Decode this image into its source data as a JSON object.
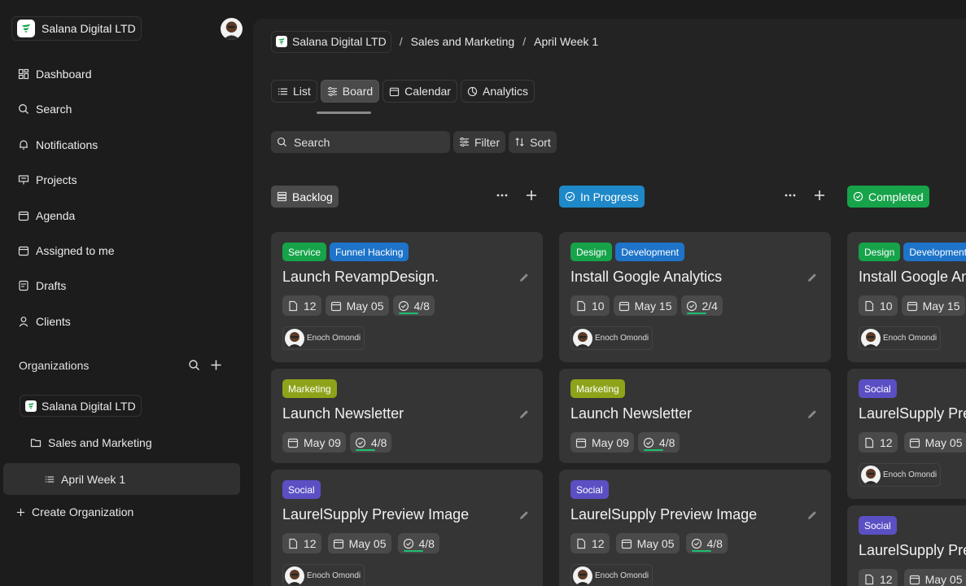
{
  "workspace": {
    "name": "Salana Digital LTD"
  },
  "sidebar": {
    "nav": [
      {
        "label": "Dashboard",
        "icon": "dashboard-icon"
      },
      {
        "label": "Search",
        "icon": "search-icon"
      },
      {
        "label": "Notifications",
        "icon": "bell-icon"
      },
      {
        "label": "Projects",
        "icon": "projects-icon"
      },
      {
        "label": "Agenda",
        "icon": "calendar-icon"
      },
      {
        "label": "Assigned to me",
        "icon": "calendar-icon"
      },
      {
        "label": "Drafts",
        "icon": "drafts-icon"
      },
      {
        "label": "Clients",
        "icon": "user-icon"
      }
    ],
    "organizations_title": "Organizations",
    "tree": {
      "org": "Salana Digital LTD",
      "folder": "Sales and Marketing",
      "list": "April Week 1"
    },
    "create_org": "Create Organization"
  },
  "breadcrumb": {
    "org": "Salana Digital LTD",
    "folder": "Sales and Marketing",
    "list": "April Week 1"
  },
  "views": [
    {
      "label": "List",
      "active": false
    },
    {
      "label": "Board",
      "active": true
    },
    {
      "label": "Calendar",
      "active": false
    },
    {
      "label": "Analytics",
      "active": false
    }
  ],
  "toolbar": {
    "search_placeholder": "Search",
    "filter": "Filter",
    "sort": "Sort"
  },
  "colors": {
    "service": "#16a34a",
    "funnel": "#1d74c9",
    "design": "#16a34a",
    "development": "#1d74c9",
    "marketing": "#8ea319",
    "social": "#5b4fc4",
    "in_progress": "#1e88c8",
    "completed": "#16a34a",
    "backlog": "#4b4b4b",
    "progress": "#1fbf70"
  },
  "columns": [
    {
      "status": "Backlog",
      "cards": [
        {
          "tags": [
            "Service",
            "Funnel Hacking"
          ],
          "title": "Launch RevampDesign.",
          "files": "12",
          "date": "May 05",
          "progress": "4/8",
          "assignee": "Enoch Omondi"
        },
        {
          "tags": [
            "Marketing"
          ],
          "title": "Launch Newsletter",
          "date": "May 09",
          "progress": "4/8"
        },
        {
          "tags": [
            "Social"
          ],
          "title": "LaurelSupply Preview Image",
          "files": "12",
          "date": "May 05",
          "progress": "4/8",
          "assignee": "Enoch Omondi"
        }
      ]
    },
    {
      "status": "In Progress",
      "cards": [
        {
          "tags": [
            "Design",
            "Development"
          ],
          "title": "Install Google Analytics",
          "files": "10",
          "date": "May 15",
          "progress": "2/4",
          "assignee": "Enoch Omondi"
        },
        {
          "tags": [
            "Marketing"
          ],
          "title": "Launch Newsletter",
          "date": "May 09",
          "progress": "4/8"
        },
        {
          "tags": [
            "Social"
          ],
          "title": "LaurelSupply Preview Image",
          "files": "12",
          "date": "May 05",
          "progress": "4/8",
          "assignee": "Enoch Omondi"
        }
      ]
    },
    {
      "status": "Completed",
      "cards": [
        {
          "tags": [
            "Design",
            "Development"
          ],
          "title": "Install Google Analytics",
          "files": "10",
          "date": "May 15",
          "assignee": "Enoch Omondi"
        },
        {
          "tags": [
            "Social"
          ],
          "title": "LaurelSupply Preview Image",
          "files": "12",
          "date": "May 05",
          "assignee": "Enoch Omondi"
        },
        {
          "tags": [
            "Social"
          ],
          "title": "LaurelSupply Preview Image",
          "files": "12",
          "date": "May 05"
        }
      ]
    }
  ]
}
